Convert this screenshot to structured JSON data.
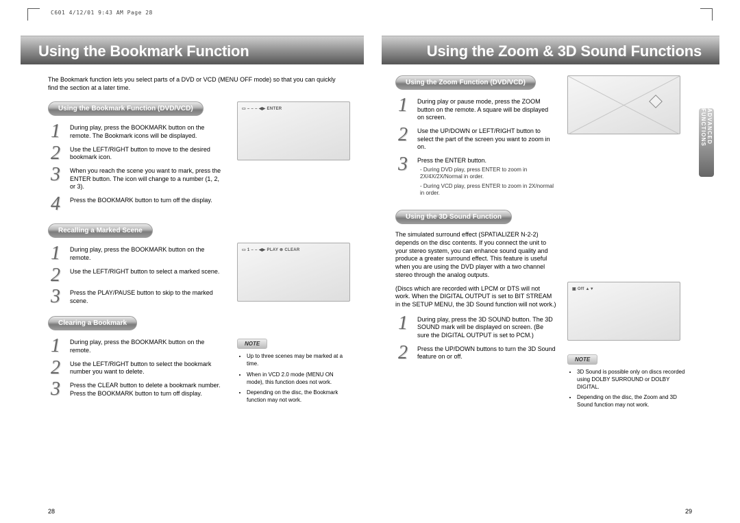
{
  "print_header": "C601  4/12/01  9:43 AM  Page 28",
  "left": {
    "title": "Using the Bookmark Function",
    "intro": "The Bookmark function lets you select parts of a DVD or VCD (MENU OFF mode) so that you can quickly find the section at a later time.",
    "page_num": "28",
    "sec1": {
      "pill": "Using the Bookmark Function (DVD/VCD)",
      "s1": "During play, press the BOOKMARK button on the remote. The Bookmark icons will be displayed.",
      "s2": "Use the LEFT/RIGHT button to move to the desired bookmark icon.",
      "s3": "When you reach the scene you want to mark, press the ENTER button. The icon will change to a number (1, 2, or 3).",
      "s4": "Press the BOOKMARK button to turn off the display.",
      "osd": "▭  –  –  –  ◀▶ ENTER"
    },
    "sec2": {
      "pill": "Recalling a Marked Scene",
      "s1": "During play, press the BOOKMARK button on the remote.",
      "s2": "Use the LEFT/RIGHT button to select a marked scene.",
      "s3": "Press the PLAY/PAUSE button to skip to the marked scene.",
      "osd": "▭ 1  –  –  ◀▶ PLAY  ⊗ CLEAR"
    },
    "sec3": {
      "pill": "Clearing a Bookmark",
      "s1": "During play, press the BOOKMARK button on the remote.",
      "s2": "Use the LEFT/RIGHT button to select the bookmark number you want to delete.",
      "s3": "Press the CLEAR button to delete a bookmark number. Press the BOOKMARK button to turn off display."
    },
    "note_label": "NOTE",
    "notes": {
      "n1": "Up to three scenes may be marked at a time.",
      "n2": "When in VCD 2.0 mode (MENU ON mode), this function does not work.",
      "n3": "Depending on the disc, the Bookmark function may not work."
    }
  },
  "right": {
    "title": "Using the Zoom & 3D Sound Functions",
    "page_num": "29",
    "side_tab": "ADVANCED FUNCTIONS",
    "sec1": {
      "pill": "Using the Zoom Function (DVD/VCD)",
      "s1": "During play or pause mode, press the ZOOM button on the remote. A square will be displayed on screen.",
      "s2": "Use the UP/DOWN or LEFT/RIGHT button to select the part of the screen you want to zoom in on.",
      "s3": "Press the ENTER button.",
      "sub1": "- During DVD play, press ENTER to zoom in 2X/4X/2X/Normal in order.",
      "sub2": "- During VCD play, press ENTER to zoom in 2X/normal in order."
    },
    "sec2": {
      "pill": "Using the 3D Sound Function",
      "para1": "The simulated surround effect (SPATIALIZER N-2-2) depends on the disc contents. If you connect the unit to your stereo system, you can enhance sound quality and produce a greater surround effect. This feature is useful when you are using the DVD player with a two channel stereo through the analog outputs.",
      "para2": "(Discs which are recorded with LPCM or DTS will not work. When the DIGITAL OUTPUT is set to BIT STREAM in the SETUP MENU, the 3D Sound function will not work.)",
      "s1": "During play, press the 3D SOUND button. The 3D SOUND mark will be displayed on screen. (Be sure the DIGITAL OUTPUT is set to PCM.)",
      "s2": "Press the UP/DOWN buttons to turn the 3D Sound feature on or off.",
      "osd": "▣ Off ▲▼"
    },
    "note_label": "NOTE",
    "notes": {
      "n1": "3D Sound is possible only on discs recorded using DOLBY SURROUND or DOLBY DIGITAL.",
      "n2": "Depending on the disc, the Zoom and 3D Sound function may not work."
    }
  }
}
